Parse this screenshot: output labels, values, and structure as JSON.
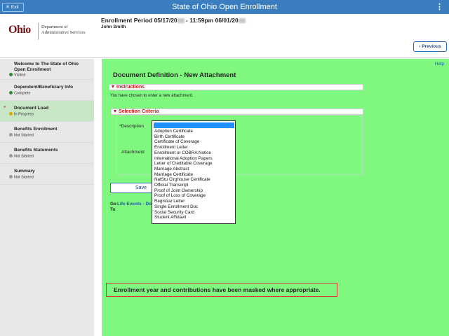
{
  "topbar": {
    "exit_label": "Exit",
    "title": "State of Ohio Open Enrollment"
  },
  "header": {
    "logo_word": "Ohio",
    "logo_dept_line1": "Department of",
    "logo_dept_line2": "Administrative Services",
    "enroll_prefix": "Enrollment Period 05/17/20",
    "enroll_mid": " - 11:59pm 06/01/20",
    "user_name": "John Smith",
    "previous_label": "Previous"
  },
  "sidebar": {
    "items": [
      {
        "title": "Welcome to The State of Ohio Open Enrollment",
        "status": "Visited",
        "status_color": "#2e8b2e"
      },
      {
        "title": "Dependent/Beneficiary Info",
        "status": "Complete",
        "status_color": "#2e8b2e"
      },
      {
        "title": "Document Load",
        "status": "In Progress",
        "status_color": "#e0a800"
      },
      {
        "title": "Benefits Enrollment",
        "status": "Not Started",
        "status_color": "#9a9a9a"
      },
      {
        "title": "Benefits Statements",
        "status": "Not Started",
        "status_color": "#9a9a9a"
      },
      {
        "title": "Summary",
        "status": "Not Started",
        "status_color": "#9a9a9a"
      }
    ],
    "active_index": 2,
    "required_marker": "*"
  },
  "main": {
    "help_label": "Help",
    "page_title": "Document Definition - New Attachment",
    "instructions_label": "Instructions",
    "instructions_text": "You have chosen to enter a new attachment.",
    "criteria_label": "Selection Criteria",
    "description_label": "*Description",
    "attachment_label": "Attachment",
    "save_label": "Save",
    "goto_prefix": "Go To",
    "goto_link": "Life Events - Do",
    "description_options": [
      "Adoption Certificate",
      "Birth Certificate",
      "Certificate of Coverage",
      "Enrollment Letter",
      "Enrollment or COBRA Notice",
      "International Adoption Papers",
      "Letter of Creditable Coverage",
      "Marriage Abstract",
      "Marriage Certificate",
      "NatStu Clrghouse Certificate",
      "Official Transcript",
      "Proof of Joint Ownership",
      "Proof of Loss of Coverage",
      "Registrar Letter",
      "Single Enrollment Doc",
      "Social Security Card",
      "Student Affidavit"
    ],
    "notice_text": "Enrollment year and contributions have been masked where appropriate."
  },
  "colors": {
    "topbar": "#3a7ebf",
    "main_bg": "#80f880",
    "sidebar_bg": "#e8e8e8",
    "accent_red": "#b71c1c",
    "link_blue": "#1f5aa8"
  }
}
